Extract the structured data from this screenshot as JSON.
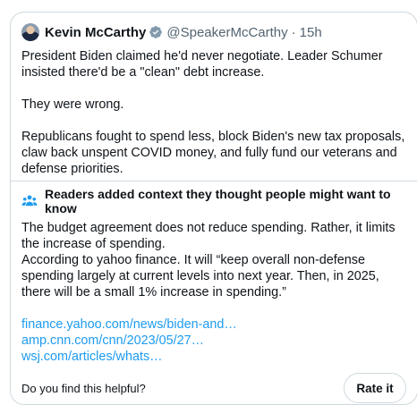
{
  "tweet": {
    "author_name": "Kevin McCarthy",
    "handle": "@SpeakerMcCarthy",
    "separator": "·",
    "time": "15h",
    "paragraphs": [
      "President Biden claimed he'd never negotiate. Leader Schumer insisted there'd be a \"clean\" debt increase.",
      "They were wrong.",
      "Republicans fought to spend less, block Biden's new tax proposals, claw back unspent COVID money, and fully fund our veterans and defense priorities."
    ]
  },
  "community_note": {
    "title": "Readers added context they thought people might want to know",
    "lines": [
      "The budget agreement does not reduce spending. Rather, it limits the increase of spending.",
      "According to yahoo finance. It will “keep overall non-defense spending largely at current levels into next year. Then, in 2025, there will be a small 1% increase in spending.”"
    ],
    "links": [
      "finance.yahoo.com/news/biden-and…",
      "amp.cnn.com/cnn/2023/05/27…",
      "wsj.com/articles/whats…"
    ],
    "helpful_question": "Do you find this helpful?",
    "rate_label": "Rate it"
  },
  "colors": {
    "link": "#1d9bf0",
    "verified_badge": "#829aab",
    "border": "#cfd9de",
    "secondary_text": "#536471"
  },
  "icons": {
    "verified": "verified-badge-icon",
    "notes": "people-group-icon"
  }
}
